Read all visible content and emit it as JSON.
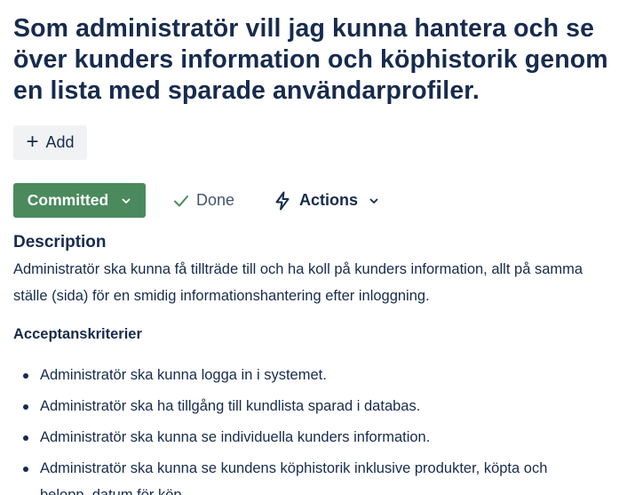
{
  "issue": {
    "title": "Som administratör vill jag kunna hantera och se över kunders information och köphistorik genom en lista med sparade användarprofiler."
  },
  "toolbar": {
    "add_label": "Add",
    "add_icon": "plus-icon",
    "status_label": "Committed",
    "status_color": "#4a8a5d",
    "done_label": "Done",
    "done_icon": "checkmark-icon",
    "actions_label": "Actions",
    "actions_icon": "lightning-bolt-icon"
  },
  "description": {
    "heading": "Description",
    "text": "Administratör ska kunna få tillträde till och ha koll på kunders information, allt på samma ställe (sida) för en smidig informationshantering efter inloggning.",
    "acceptance_heading": "Acceptanskriterier",
    "acceptance_items": [
      "Administratör ska kunna logga in i systemet.",
      "Administratör ska ha tillgång till kundlista sparad i databas.",
      "Administratör ska kunna se individuella kunders information.",
      "Administratör ska kunna se kundens köphistorik inklusive produkter, köpta och belopp, datum för köp."
    ]
  }
}
